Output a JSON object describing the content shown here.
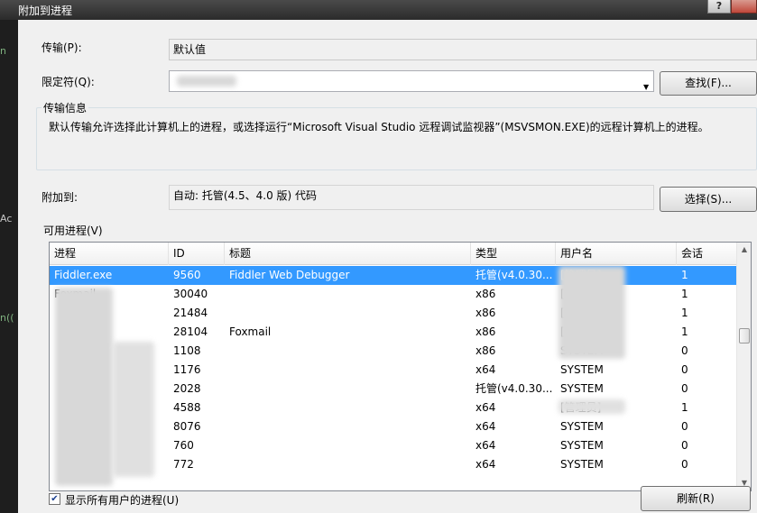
{
  "window": {
    "title": "附加到进程",
    "help_label": "?"
  },
  "transport": {
    "label": "传输(P):",
    "value": "默认值"
  },
  "qualifier": {
    "label": "限定符(Q):",
    "value": ""
  },
  "find_button": "查找(F)...",
  "transport_info": {
    "title": "传输信息",
    "text": "默认传输允许选择此计算机上的进程，或选择运行“Microsoft Visual Studio 远程调试监视器”(MSVSMON.EXE)的远程计算机上的进程。"
  },
  "attach_to": {
    "label": "附加到:",
    "value": "自动: 托管(4.5、4.0 版) 代码"
  },
  "select_button": "选择(S)...",
  "processes": {
    "title": "可用进程(V)",
    "columns": [
      "进程",
      "ID",
      "标题",
      "类型",
      "用户名",
      "会话"
    ],
    "rows": [
      {
        "process": "Fiddler.exe",
        "id": "9560",
        "title": "Fiddler Web Debugger",
        "type": "托管(v4.0.30...",
        "user": "[管理员]",
        "session": "1",
        "selected": true
      },
      {
        "process": "Foxmail...",
        "id": "30040",
        "title": "",
        "type": "x86",
        "user": "[管理员]",
        "session": "1"
      },
      {
        "process": "",
        "id": "21484",
        "title": "",
        "type": "x86",
        "user": "[管理员]",
        "session": "1"
      },
      {
        "process": "",
        "id": "28104",
        "title": "Foxmail",
        "type": "x86",
        "user": "[管理员]",
        "session": "1"
      },
      {
        "process": "",
        "id": "1108",
        "title": "",
        "type": "x86",
        "user": "SYSTEM",
        "session": "0"
      },
      {
        "process": "",
        "id": "1176",
        "title": "",
        "type": "x64",
        "user": "SYSTEM",
        "session": "0"
      },
      {
        "process": "",
        "id": "2028",
        "title": "",
        "type": "托管(v4.0.30...",
        "user": "SYSTEM",
        "session": "0"
      },
      {
        "process": "",
        "id": "4588",
        "title": "",
        "type": "x64",
        "user": "[管理员]",
        "session": "1"
      },
      {
        "process": "",
        "id": "8076",
        "title": "",
        "type": "x64",
        "user": "SYSTEM",
        "session": "0"
      },
      {
        "process": "",
        "id": "760",
        "title": "",
        "type": "x64",
        "user": "SYSTEM",
        "session": "0"
      },
      {
        "process": "",
        "id": "772",
        "title": "",
        "type": "x64",
        "user": "SYSTEM",
        "session": "0"
      }
    ]
  },
  "show_all_users": {
    "label": "显示所有用户的进程(U)",
    "checked": true
  },
  "refresh_button": "刷新(R)",
  "background_fragments": {
    "frag1": "n",
    "frag2": "Ac",
    "frag3": "n(("
  },
  "colors": {
    "selection": "#3399ff",
    "dialog_bg": "#f0f0f0"
  }
}
